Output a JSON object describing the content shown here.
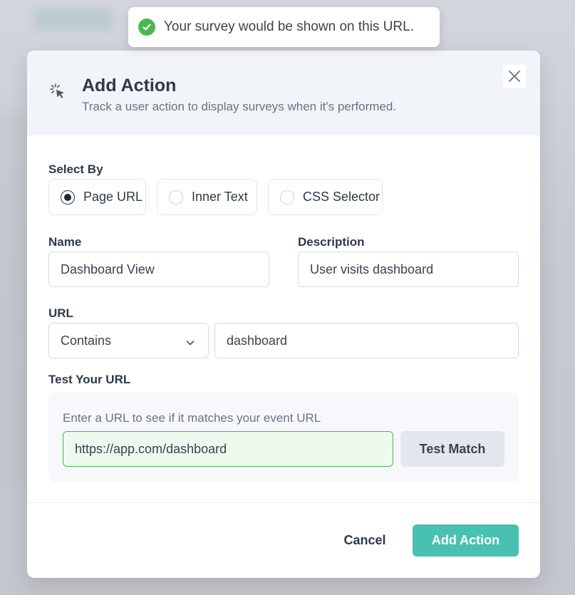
{
  "toast": {
    "message": "Your survey would be shown on this URL.",
    "icon": "check-circle-icon",
    "color": "#4cb84c"
  },
  "modal": {
    "title": "Add Action",
    "subtitle": "Track a user action to display surveys when it's performed.",
    "icon": "cursor-click-icon"
  },
  "select_by": {
    "label": "Select By",
    "options": [
      {
        "label": "Page URL",
        "checked": true
      },
      {
        "label": "Inner Text",
        "checked": false
      },
      {
        "label": "CSS Selector",
        "checked": false
      }
    ]
  },
  "name_field": {
    "label": "Name",
    "value": "Dashboard View"
  },
  "description_field": {
    "label": "Description",
    "value": "User visits dashboard"
  },
  "url": {
    "label": "URL",
    "match_type": "Contains",
    "value": "dashboard"
  },
  "test_url": {
    "label": "Test Your URL",
    "hint": "Enter a URL to see if it matches your event URL",
    "value": "https://app.com/dashboard",
    "button_label": "Test Match"
  },
  "footer": {
    "cancel_label": "Cancel",
    "submit_label": "Add Action",
    "accent": "#49c1b0"
  }
}
